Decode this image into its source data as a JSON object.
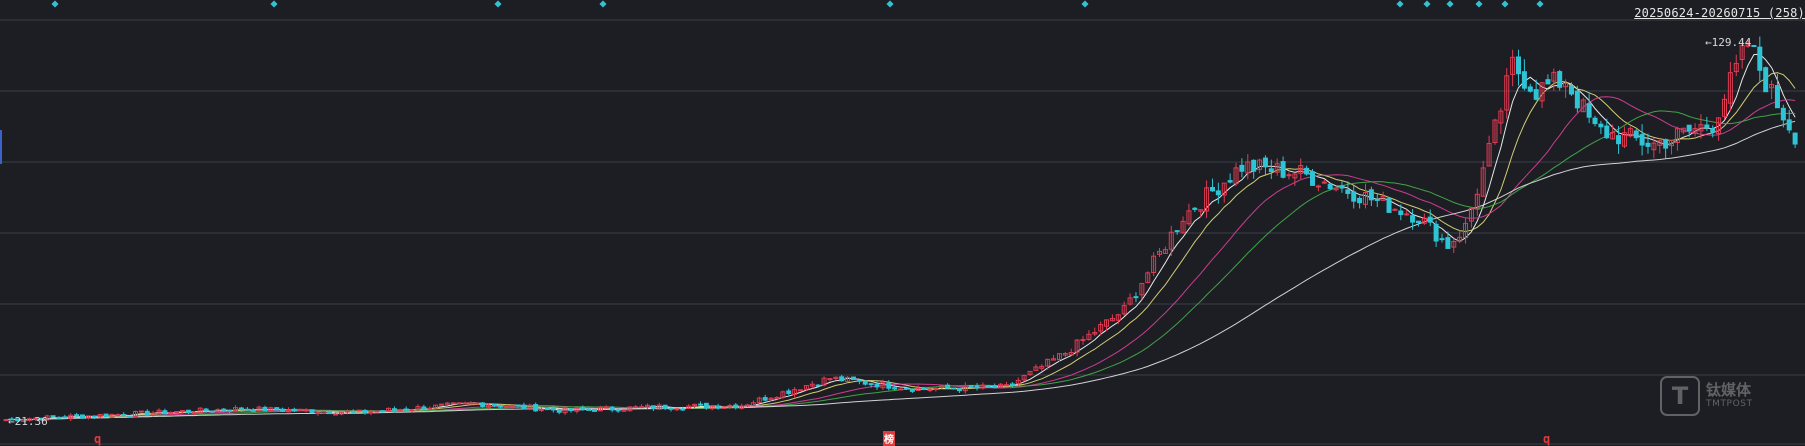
{
  "header": {
    "date_range": "20250624-20260715 (258)"
  },
  "labels": {
    "high": "129.44",
    "low": "21.36"
  },
  "markers": [
    {
      "name": "marker-q-1",
      "text": "q"
    },
    {
      "name": "marker-bang",
      "text": "榜"
    },
    {
      "name": "marker-q-2",
      "text": "q"
    }
  ],
  "watermark": {
    "logo": "T",
    "cn": "钛媒体",
    "en": "TMTPOST"
  },
  "colors": {
    "background": "#1c1e24",
    "grid": "#3a3d46",
    "up": "#e03b52",
    "down": "#2ec4d6",
    "ma5": "#ffffff",
    "ma10": "#e5e07a",
    "ma20": "#e0409a",
    "ma30": "#46b04a",
    "ma60": "#e6e6e6"
  },
  "chart_data": {
    "type": "candlestick",
    "x_range": [
      "20250624",
      "20260715"
    ],
    "bar_count": 258,
    "y_high": 129.44,
    "y_low": 21.36,
    "ylim": [
      20,
      132
    ],
    "grid": true,
    "moving_averages": [
      "MA5",
      "MA10",
      "MA20",
      "MA30",
      "MA60"
    ],
    "close_path": [
      [
        0,
        21.5
      ],
      [
        20,
        23.0
      ],
      [
        40,
        24.5
      ],
      [
        60,
        23.5
      ],
      [
        80,
        26.0
      ],
      [
        95,
        24.0
      ],
      [
        110,
        25.0
      ],
      [
        125,
        25.5
      ],
      [
        140,
        33.0
      ],
      [
        155,
        30.0
      ],
      [
        170,
        30.5
      ],
      [
        180,
        40.0
      ],
      [
        190,
        52.0
      ],
      [
        200,
        78.0
      ],
      [
        210,
        92.0
      ],
      [
        220,
        90.0
      ],
      [
        230,
        84.0
      ],
      [
        240,
        78.0
      ],
      [
        245,
        70.0
      ],
      [
        248,
        75.0
      ],
      [
        252,
        96.0
      ],
      [
        256,
        120.0
      ],
      [
        260,
        113.0
      ],
      [
        265,
        116.0
      ],
      [
        270,
        102.0
      ],
      [
        280,
        98.0
      ],
      [
        290,
        104.0
      ],
      [
        296,
        126.0
      ],
      [
        300,
        112.0
      ],
      [
        305,
        98.0
      ]
    ]
  }
}
